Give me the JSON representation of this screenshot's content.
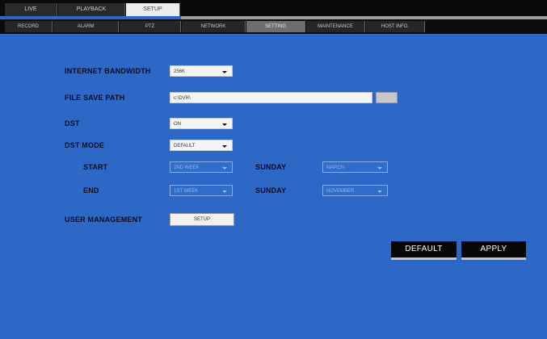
{
  "top_tabs": [
    {
      "label": "LIVE"
    },
    {
      "label": "PLAYBACK"
    },
    {
      "label": "SETUP"
    }
  ],
  "sub_tabs": [
    {
      "label": "RECORD"
    },
    {
      "label": "ALARM"
    },
    {
      "label": "PTZ"
    },
    {
      "label": "NETWORK"
    },
    {
      "label": "SETTING"
    },
    {
      "label": "MAINTENANCE"
    },
    {
      "label": "HOST INFO."
    }
  ],
  "form": {
    "internet_bandwidth": {
      "label": "INTERNET BANDWIDTH",
      "value": "256K"
    },
    "file_save_path": {
      "label": "FILE SAVE PATH",
      "value": "c:\\DVR\\",
      "browse_label": "..."
    },
    "dst": {
      "label": "DST",
      "value": "ON"
    },
    "dst_mode": {
      "label": "DST MODE",
      "value": "DEFAULT"
    },
    "start": {
      "label": "START",
      "week": "2ND WEEK",
      "day_label": "SUNDAY",
      "month": "MARCH"
    },
    "end": {
      "label": "END",
      "week": "1ST WEEK",
      "day_label": "SUNDAY",
      "month": "NOVEMBER"
    },
    "user_management": {
      "label": "USER MANAGEMENT",
      "button_label": "SETUP"
    }
  },
  "actions": {
    "default_label": "DEFAULT",
    "apply_label": "APPLY"
  },
  "colors": {
    "panel_blue": "#2d68c6",
    "bar_black": "#0a0a0a",
    "active_tab": "#ececec"
  }
}
